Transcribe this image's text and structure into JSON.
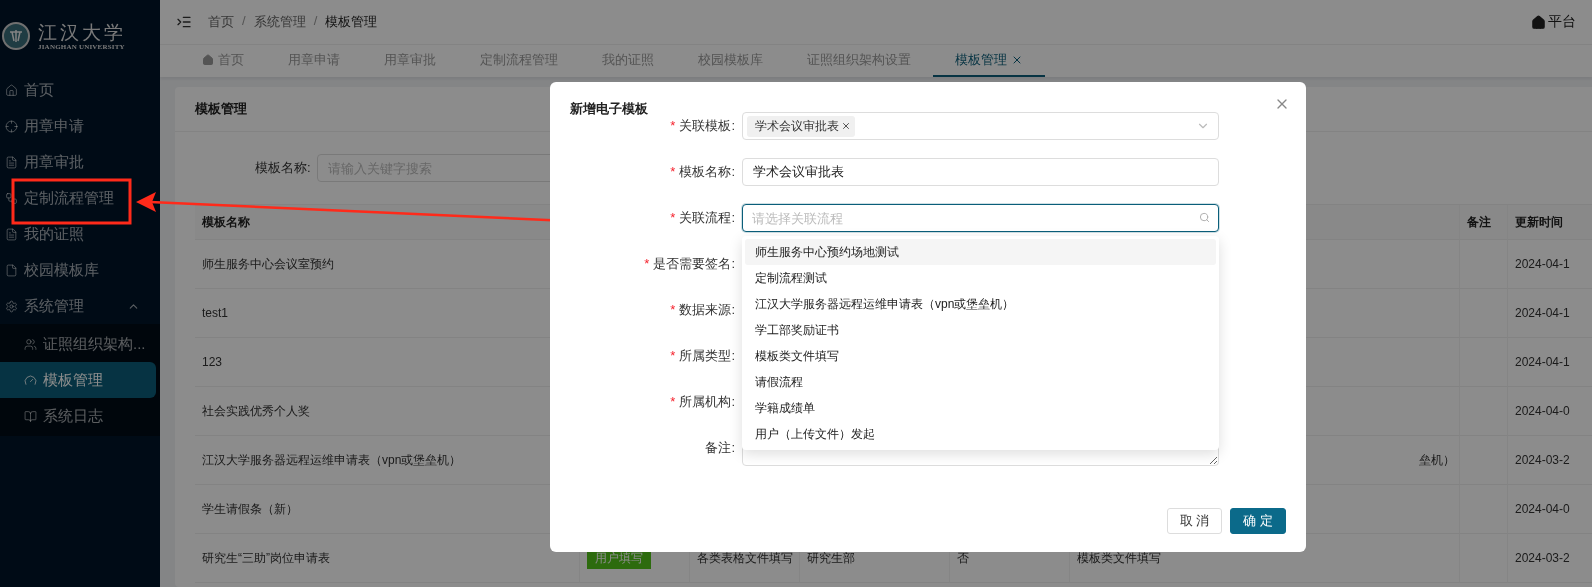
{
  "sidebar": {
    "logo": {
      "name": "江汉大学",
      "subtitle": "JIANGHAN UNIVERSITY"
    },
    "items": [
      {
        "label": "首页",
        "selected": false
      },
      {
        "label": "用章申请",
        "selected": false
      },
      {
        "label": "用章审批",
        "selected": false
      },
      {
        "label": "定制流程管理",
        "selected": false
      },
      {
        "label": "我的证照",
        "selected": false
      },
      {
        "label": "校园模板库",
        "selected": false
      },
      {
        "label": "系统管理",
        "selected": false,
        "expanded": true,
        "children": [
          {
            "label": "证照组织架构...",
            "selected": false
          },
          {
            "label": "模板管理",
            "selected": true
          },
          {
            "label": "系统日志",
            "selected": false
          }
        ]
      }
    ]
  },
  "header": {
    "breadcrumb": [
      "首页",
      "系统管理",
      "模板管理"
    ],
    "separator": "/",
    "platform": "平台"
  },
  "tabs": [
    {
      "label": "首页",
      "home": true,
      "selected": false
    },
    {
      "label": "用章申请",
      "selected": false
    },
    {
      "label": "用章审批",
      "selected": false
    },
    {
      "label": "定制流程管理",
      "selected": false
    },
    {
      "label": "我的证照",
      "selected": false
    },
    {
      "label": "校园模板库",
      "selected": false
    },
    {
      "label": "证照组织架构设置",
      "selected": false
    },
    {
      "label": "模板管理",
      "selected": true
    }
  ],
  "card": {
    "title": "模板管理",
    "search": {
      "label": "模板名称:",
      "placeholder": "请输入关键字搜索"
    }
  },
  "table": {
    "columns": {
      "name": "模板名称",
      "remark": "备注",
      "updated": "更新时间"
    },
    "rows": [
      {
        "name": "师生服务中心会议室预约",
        "updated": "2024-04-1"
      },
      {
        "name": "test1",
        "updated": "2024-04-1"
      },
      {
        "name": "123",
        "updated": "2024-04-1"
      },
      {
        "name": "社会实践优秀个人奖",
        "updated": "2024-04-0"
      },
      {
        "name": "江汉大学服务器远程运维申请表（vpn或堡垒机）",
        "column_6": "垒机）",
        "updated": "2024-03-2"
      },
      {
        "name": "学生请假条（新）",
        "updated": "2024-04-0"
      },
      {
        "name": "研究生“三助”岗位申请表",
        "tag": "用户填写",
        "column_3": "各类表格文件填写",
        "column_4": "研究生部",
        "column_5": "否",
        "column_6": "模板类文件填写",
        "updated": "2024-03-2"
      }
    ]
  },
  "dialog": {
    "title": "新增电子模板",
    "required_mark": "*",
    "fields": [
      {
        "label": "关联模板:",
        "required": true,
        "kind": "tags",
        "tags": [
          "学术会议审批表"
        ]
      },
      {
        "label": "模板名称:",
        "required": true,
        "kind": "input",
        "value": "学术会议审批表"
      },
      {
        "label": "关联流程:",
        "required": true,
        "kind": "search",
        "placeholder": "请选择关联流程",
        "focused": true,
        "options": [
          {
            "label": "师生服务中心预约场地测试",
            "selected": true
          },
          {
            "label": "定制流程测试",
            "selected": false
          },
          {
            "label": "江汉大学服务器远程运维申请表（vpn或堡垒机）",
            "selected": false
          },
          {
            "label": "学工部奖励证书",
            "selected": false
          },
          {
            "label": "模板类文件填写",
            "selected": false
          },
          {
            "label": "请假流程",
            "selected": false
          },
          {
            "label": "学籍成绩单",
            "selected": false
          },
          {
            "label": "用户（上传文件）发起",
            "selected": false
          }
        ]
      },
      {
        "label": "是否需要签名:",
        "required": true,
        "kind": "hidden"
      },
      {
        "label": "数据来源:",
        "required": true,
        "kind": "hidden"
      },
      {
        "label": "所属类型:",
        "required": true,
        "kind": "hidden"
      },
      {
        "label": "所属机构:",
        "required": true,
        "kind": "hidden"
      },
      {
        "label": "备注:",
        "required": false,
        "kind": "textarea"
      }
    ],
    "buttons": [
      {
        "label": "取 消",
        "primary": false
      },
      {
        "label": "确 定",
        "primary": true
      }
    ]
  },
  "annotation": {
    "shown": true
  }
}
